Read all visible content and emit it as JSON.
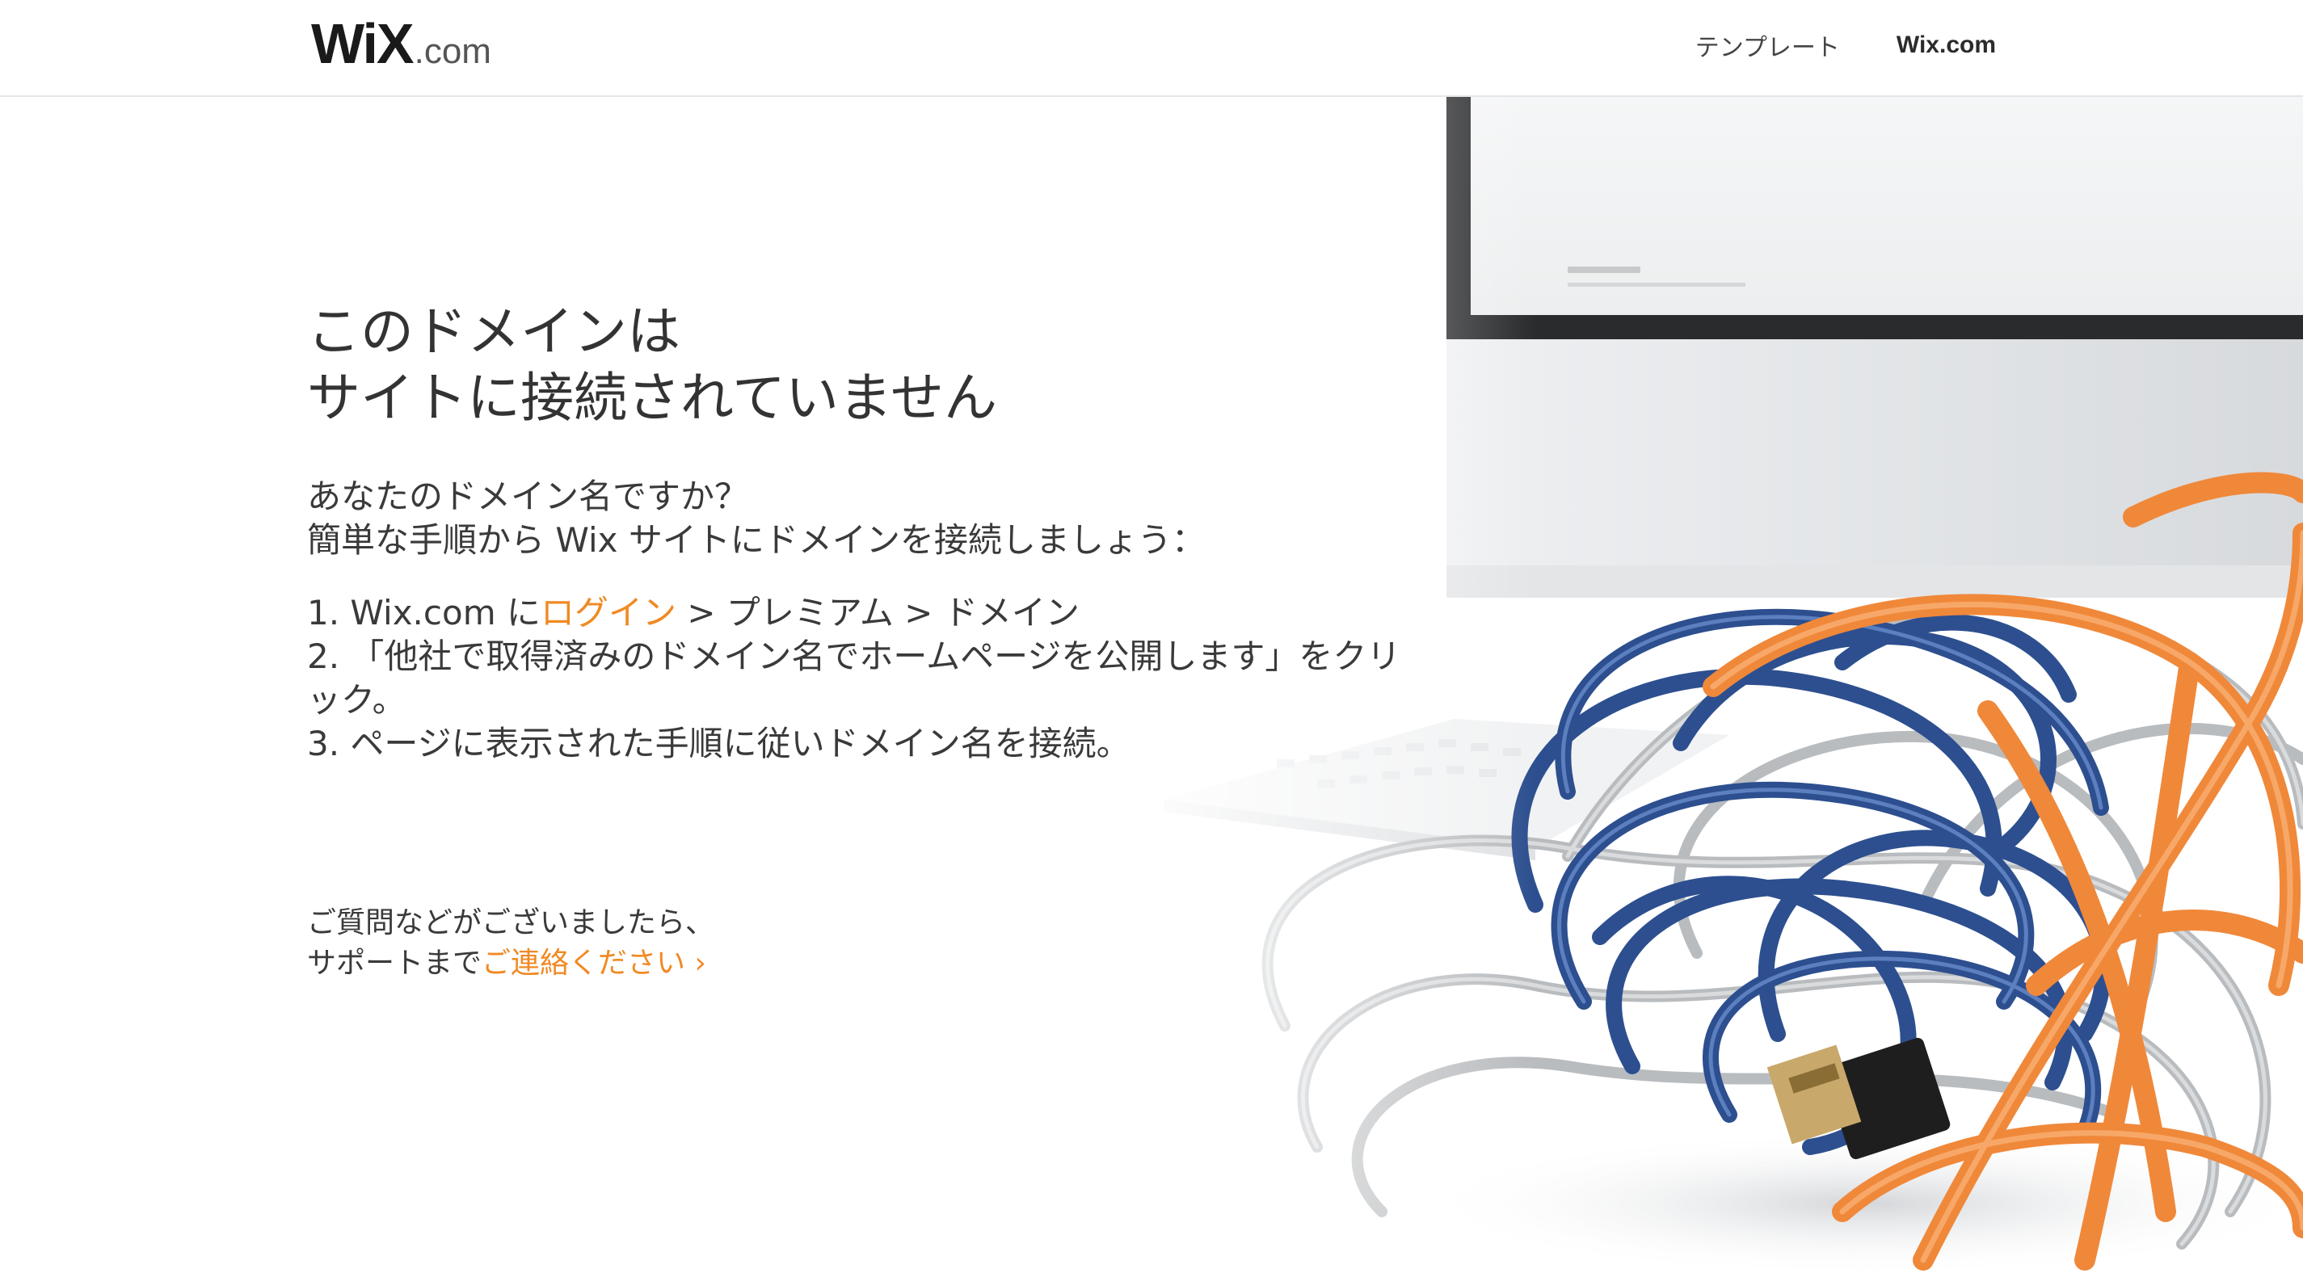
{
  "header": {
    "logo": {
      "wix": "WiX",
      "com": ".com"
    },
    "nav": [
      {
        "label": "テンプレート"
      },
      {
        "label": "Wix.com"
      }
    ]
  },
  "main": {
    "title_line1": "このドメインは",
    "title_line2": "サイトに接続されていません",
    "question": "あなたのドメイン名ですか？",
    "instruction": "簡単な手順から Wix サイトにドメインを接続しましょう：",
    "steps": [
      {
        "prefix": "1. Wix.com に",
        "link": "ログイン",
        "suffix": " > プレミアム > ドメイン"
      },
      {
        "text": "2. 「他社で取得済みのドメイン名でホームページを公開します」をクリック。"
      },
      {
        "text": "3. ページに表示された手順に従いドメイン名を接続。"
      }
    ]
  },
  "support": {
    "line1": "ご質問などがございましたら、",
    "prefix": "サポートまで",
    "link": "ご連絡ください ›"
  },
  "colors": {
    "accent": "#f08a24",
    "text": "#333333",
    "cable_blue": "#2d4f8f",
    "cable_orange": "#f0883a",
    "cable_silver": "#b9bcbf"
  },
  "icons": [
    "monitor-image",
    "keyboard-image",
    "tangled-cables-image",
    "usb-plug-image"
  ]
}
